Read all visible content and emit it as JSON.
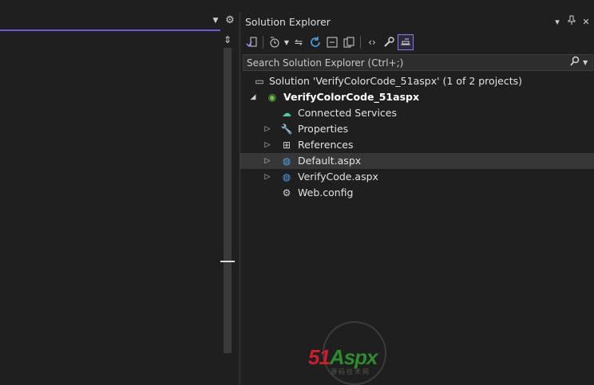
{
  "panel": {
    "title": "Solution Explorer",
    "search_placeholder": "Search Solution Explorer (Ctrl+;)"
  },
  "tree": [
    {
      "name": "solution-node",
      "label": "Solution 'VerifyColorCode_51aspx' (1 of 2 projects)",
      "level": 0,
      "expander": "",
      "icon": "solution-icon",
      "glyph": "▭",
      "bold": false,
      "selected": false
    },
    {
      "name": "project-node",
      "label": "VerifyColorCode_51aspx",
      "level": 1,
      "expander": "expanded",
      "icon": "web-project-icon",
      "glyph": "◉",
      "bold": true,
      "selected": false
    },
    {
      "name": "connected-services-node",
      "label": "Connected Services",
      "level": 2,
      "expander": "",
      "icon": "connected-services-icon",
      "glyph": "☁",
      "bold": false,
      "selected": false
    },
    {
      "name": "properties-node",
      "label": "Properties",
      "level": 2,
      "expander": "collapsed",
      "icon": "wrench-icon",
      "glyph": "🔧",
      "bold": false,
      "selected": false
    },
    {
      "name": "references-node",
      "label": "References",
      "level": 2,
      "expander": "collapsed",
      "icon": "references-icon",
      "glyph": "⊞",
      "bold": false,
      "selected": false
    },
    {
      "name": "default-aspx-node",
      "label": "Default.aspx",
      "level": 2,
      "expander": "collapsed",
      "icon": "aspx-file-icon",
      "glyph": "◍",
      "bold": false,
      "selected": true
    },
    {
      "name": "verifycode-aspx-node",
      "label": "VerifyCode.aspx",
      "level": 2,
      "expander": "collapsed",
      "icon": "aspx-file-icon",
      "glyph": "◍",
      "bold": false,
      "selected": false
    },
    {
      "name": "web-config-node",
      "label": "Web.config",
      "level": 2,
      "expander": "",
      "icon": "config-file-icon",
      "glyph": "⚙",
      "bold": false,
      "selected": false
    }
  ],
  "icons": {
    "accent": "#6f5bd3",
    "project_green": "#6cc04a",
    "globe_blue": "#4ea3e6",
    "service_teal": "#4ec9b0"
  },
  "watermark": {
    "text_red": "51",
    "text_rest": "Aspx",
    "sub": "源码技术网"
  }
}
